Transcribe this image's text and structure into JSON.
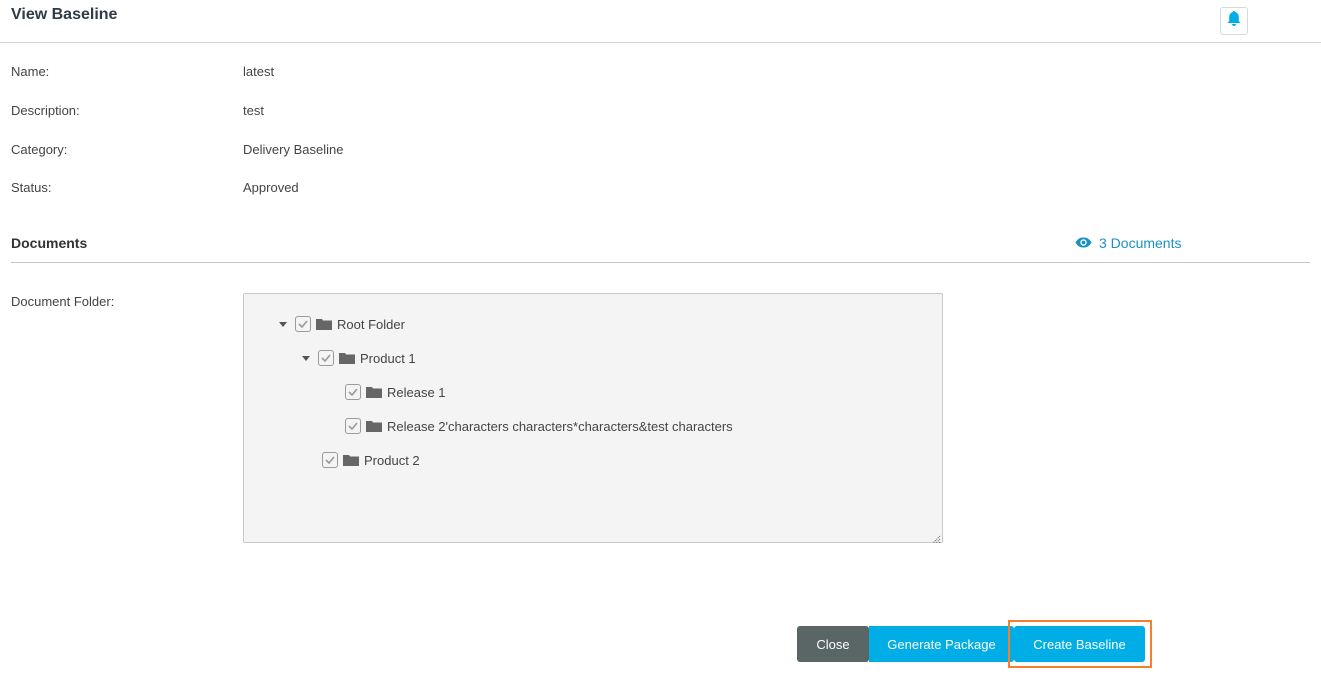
{
  "header": {
    "title": "View Baseline",
    "notification_icon": "bell-icon",
    "accent_color": "#00ade6"
  },
  "fields": [
    {
      "label": "Name:",
      "value": "latest"
    },
    {
      "label": "Description:",
      "value": "test"
    },
    {
      "label": "Category:",
      "value": "Delivery Baseline"
    },
    {
      "label": "Status:",
      "value": "Approved"
    }
  ],
  "documents": {
    "section_title": "Documents",
    "view_link": "3 Documents",
    "view_icon": "eye-icon",
    "folder_label": "Document Folder:",
    "tree": [
      {
        "label": "Root Folder",
        "expanded": true,
        "checked": true,
        "level": 0
      },
      {
        "label": "Product 1",
        "expanded": true,
        "checked": true,
        "level": 1
      },
      {
        "label": "Release 1",
        "checked": true,
        "level": 2
      },
      {
        "label": "Release 2'characters characters*characters&test characters",
        "checked": true,
        "level": 2
      },
      {
        "label": "Product 2",
        "checked": true,
        "level": 1
      }
    ]
  },
  "actions": {
    "close_label": "Close",
    "generate_label": "Generate Package",
    "create_label": "Create Baseline",
    "highlight_color": "#f57f2a"
  }
}
